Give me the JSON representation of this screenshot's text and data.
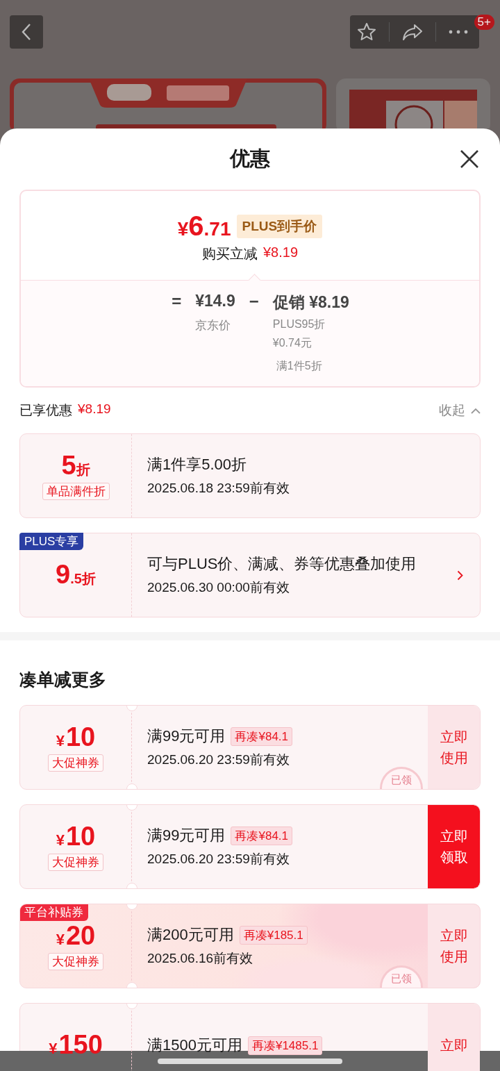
{
  "top_bar": {
    "badge": "5+"
  },
  "sheet": {
    "title": "优惠"
  },
  "price_card": {
    "currency": "¥",
    "price_int": "6",
    "price_dec": ".71",
    "price_tag": "PLUS到手价",
    "saving_label": "购买立减",
    "saving_value": "¥8.19",
    "breakdown": {
      "equals": "=",
      "base_value": "¥14.9",
      "base_label": "京东价",
      "minus": "−",
      "promo_value": "促销 ¥8.19",
      "promo_details": [
        "PLUS95折",
        "¥0.74元",
        "满1件5折"
      ]
    }
  },
  "enjoyed": {
    "label": "已享优惠",
    "value": "¥8.19",
    "toggle": "收起",
    "expanded": true
  },
  "discounts": [
    {
      "amount": "5",
      "unit": "折",
      "tag": "单品满件折",
      "title": "满1件享5.00折",
      "validity": "2025.06.18 23:59前有效",
      "has_arrow": false
    },
    {
      "ribbon": "PLUS专享",
      "amount": "9",
      "amount_decimal": ".5",
      "unit": "折",
      "title": "可与PLUS价、满减、券等优惠叠加使用",
      "validity": "2025.06.30 00:00前有效",
      "has_arrow": true
    }
  ],
  "more": {
    "title": "凑单减更多"
  },
  "coupons": [
    {
      "kind": "plain",
      "currency": "¥",
      "amount": "10",
      "tag": "大促神券",
      "title": "满99元可用",
      "gap": "再凑¥84.1",
      "validity": "2025.06.20 23:59前有效",
      "action": "立即使用",
      "claimed": true,
      "stamp": "已领"
    },
    {
      "kind": "plain",
      "currency": "¥",
      "amount": "10",
      "tag": "大促神券",
      "title": "满99元可用",
      "gap": "再凑¥84.1",
      "validity": "2025.06.20 23:59前有效",
      "action": "立即领取",
      "claimed": false
    },
    {
      "kind": "festive",
      "ribbon": "平台补贴券",
      "currency": "¥",
      "amount": "20",
      "tag": "大促神券",
      "title": "满200元可用",
      "gap": "再凑¥185.1",
      "validity": "2025.06.16前有效",
      "action": "立即使用",
      "claimed": true,
      "stamp": "已领"
    },
    {
      "kind": "plain",
      "currency": "¥",
      "amount": "150",
      "title": "满1500元可用",
      "gap": "再凑¥1485.1",
      "action": "立即",
      "claimed": true
    }
  ]
}
